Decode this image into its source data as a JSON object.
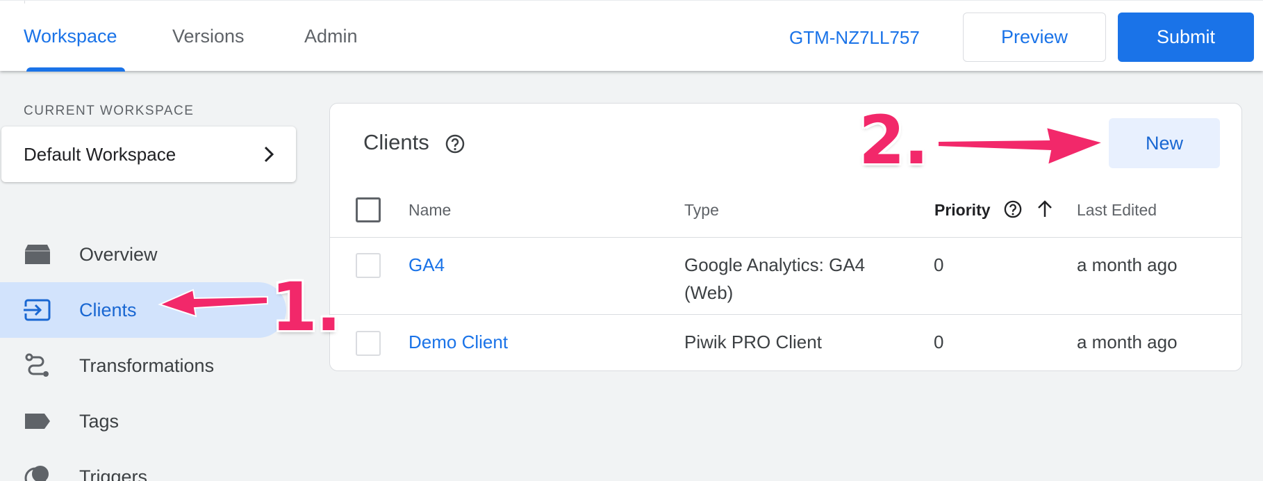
{
  "header": {
    "tabs": [
      {
        "label": "Workspace",
        "active": true
      },
      {
        "label": "Versions",
        "active": false
      },
      {
        "label": "Admin",
        "active": false
      }
    ],
    "container_id": "GTM-NZ7LL757",
    "preview_label": "Preview",
    "submit_label": "Submit"
  },
  "sidebar": {
    "workspace_heading": "CURRENT WORKSPACE",
    "workspace_name": "Default Workspace",
    "items": [
      {
        "label": "Overview",
        "icon": "overview-icon",
        "active": false
      },
      {
        "label": "Clients",
        "icon": "clients-icon",
        "active": true
      },
      {
        "label": "Transformations",
        "icon": "transformations-icon",
        "active": false
      },
      {
        "label": "Tags",
        "icon": "tag-icon",
        "active": false
      },
      {
        "label": "Triggers",
        "icon": "trigger-icon",
        "active": false
      }
    ]
  },
  "clients_panel": {
    "title": "Clients",
    "new_label": "New",
    "columns": {
      "name": "Name",
      "type": "Type",
      "priority": "Priority",
      "last_edited": "Last Edited"
    },
    "rows": [
      {
        "name": "GA4",
        "type_line1": "Google Analytics: GA4",
        "type_line2": "(Web)",
        "priority": "0",
        "last_edited": "a month ago"
      },
      {
        "name": "Demo Client",
        "type_line1": "Piwik PRO Client",
        "type_line2": "",
        "priority": "0",
        "last_edited": "a month ago"
      }
    ]
  },
  "annotations": {
    "step1": "1.",
    "step2": "2.",
    "color": "#f2286a"
  },
  "colors": {
    "accent": "#1a73e8",
    "active_nav_bg": "#d2e3fc",
    "page_bg": "#f1f3f4"
  }
}
